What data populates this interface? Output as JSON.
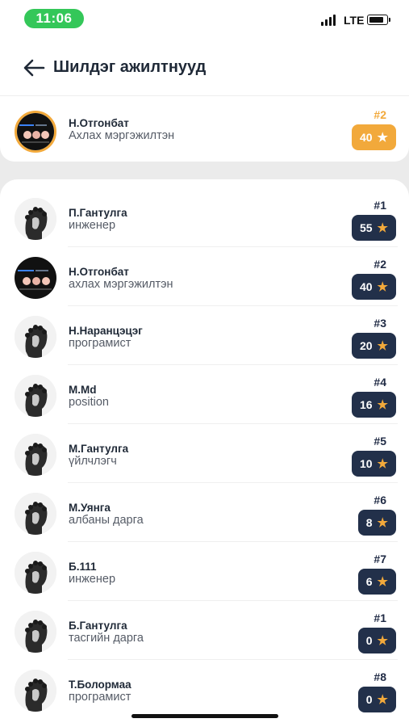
{
  "status_bar": {
    "time": "11:06",
    "network": "LTE"
  },
  "header": {
    "title": "Шилдэг ажилтнууд"
  },
  "current_user": {
    "name": "Н.Отгонбат",
    "position": "Ахлах мэргэжилтэн",
    "rank": "#2",
    "points": "40",
    "avatar": "screen-avatar"
  },
  "employees": [
    {
      "name": "П.Гантулга",
      "position": "инженер",
      "rank": "#1",
      "points": "55",
      "avatar": "portrait-avatar"
    },
    {
      "name": "Н.Отгонбат",
      "position": "ахлах мэргэжилтэн",
      "rank": "#2",
      "points": "40",
      "avatar": "screen-avatar"
    },
    {
      "name": "Н.Наранцэцэг",
      "position": "програмист",
      "rank": "#3",
      "points": "20",
      "avatar": "portrait-avatar"
    },
    {
      "name": "М.Md",
      "position": "position",
      "rank": "#4",
      "points": "16",
      "avatar": "portrait-avatar"
    },
    {
      "name": "М.Гантулга",
      "position": "үйлчлэгч",
      "rank": "#5",
      "points": "10",
      "avatar": "portrait-avatar"
    },
    {
      "name": "М.Уянга",
      "position": "албаны дарга",
      "rank": "#6",
      "points": "8",
      "avatar": "portrait-avatar"
    },
    {
      "name": "Б.111",
      "position": "инженер",
      "rank": "#7",
      "points": "6",
      "avatar": "portrait-avatar"
    },
    {
      "name": "Б.Гантулга",
      "position": "тасгийн дарга",
      "rank": "#1",
      "points": "0",
      "avatar": "portrait-avatar"
    },
    {
      "name": "Т.Болормаа",
      "position": "програмист",
      "rank": "#8",
      "points": "0",
      "avatar": "portrait-avatar"
    }
  ],
  "colors": {
    "accent_gold": "#f2a93b",
    "badge_navy": "#22304a",
    "status_green": "#34c759"
  }
}
